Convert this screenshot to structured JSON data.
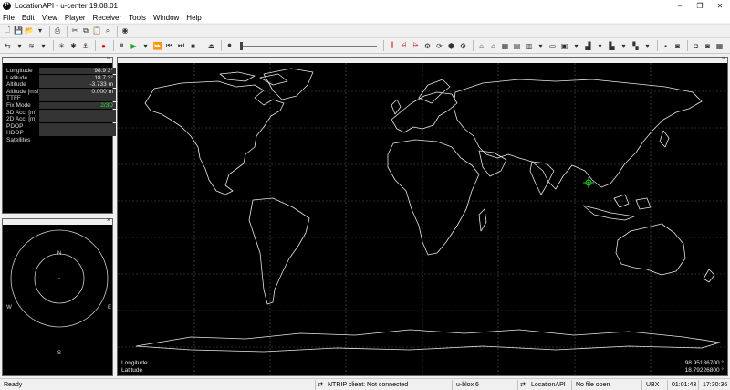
{
  "window": {
    "title": "LocationAPI - u-center 19.08.01",
    "controls": [
      "–",
      "❐",
      "✕"
    ]
  },
  "menu": [
    "File",
    "Edit",
    "View",
    "Player",
    "Receiver",
    "Tools",
    "Window",
    "Help"
  ],
  "data_view": {
    "rows": [
      {
        "label": "Longitude",
        "value": "98.9 3°"
      },
      {
        "label": "Latitude",
        "value": "18.7 3°"
      },
      {
        "label": "Altitude",
        "value": "-3.733 m"
      },
      {
        "label": "Altitude [msl]",
        "value": "0.000 m"
      },
      {
        "label": "TTFF",
        "value": ""
      },
      {
        "label": "Fix Mode",
        "value": "2/3D"
      },
      {
        "label": "3D Acc. [m]",
        "value": ""
      },
      {
        "label": "2D Acc. [m]",
        "value": ""
      },
      {
        "label": "PDOP",
        "value": ""
      },
      {
        "label": "HDOP",
        "value": ""
      },
      {
        "label": "Satellites",
        "value": ""
      }
    ]
  },
  "sky_view": {
    "north": "N",
    "south": "S",
    "east": "E",
    "west": "W"
  },
  "map_view": {
    "longitude_label": "Longitude",
    "latitude_label": "Latitude",
    "longitude_value": "98.95186700 °",
    "latitude_value": "18.79226800 °",
    "land_color": "#e8e8e8",
    "marker_color": "#22cc22",
    "grid_color": "#555555"
  },
  "status": {
    "ready": "Ready",
    "ntrip": "NTRIP client: Not connected",
    "receiver": "u-blox 6",
    "connection": "LocationAPI",
    "file": "No file open",
    "protocol": "UBX",
    "elapsed": "01:01:43",
    "clock": "17:30:36"
  }
}
